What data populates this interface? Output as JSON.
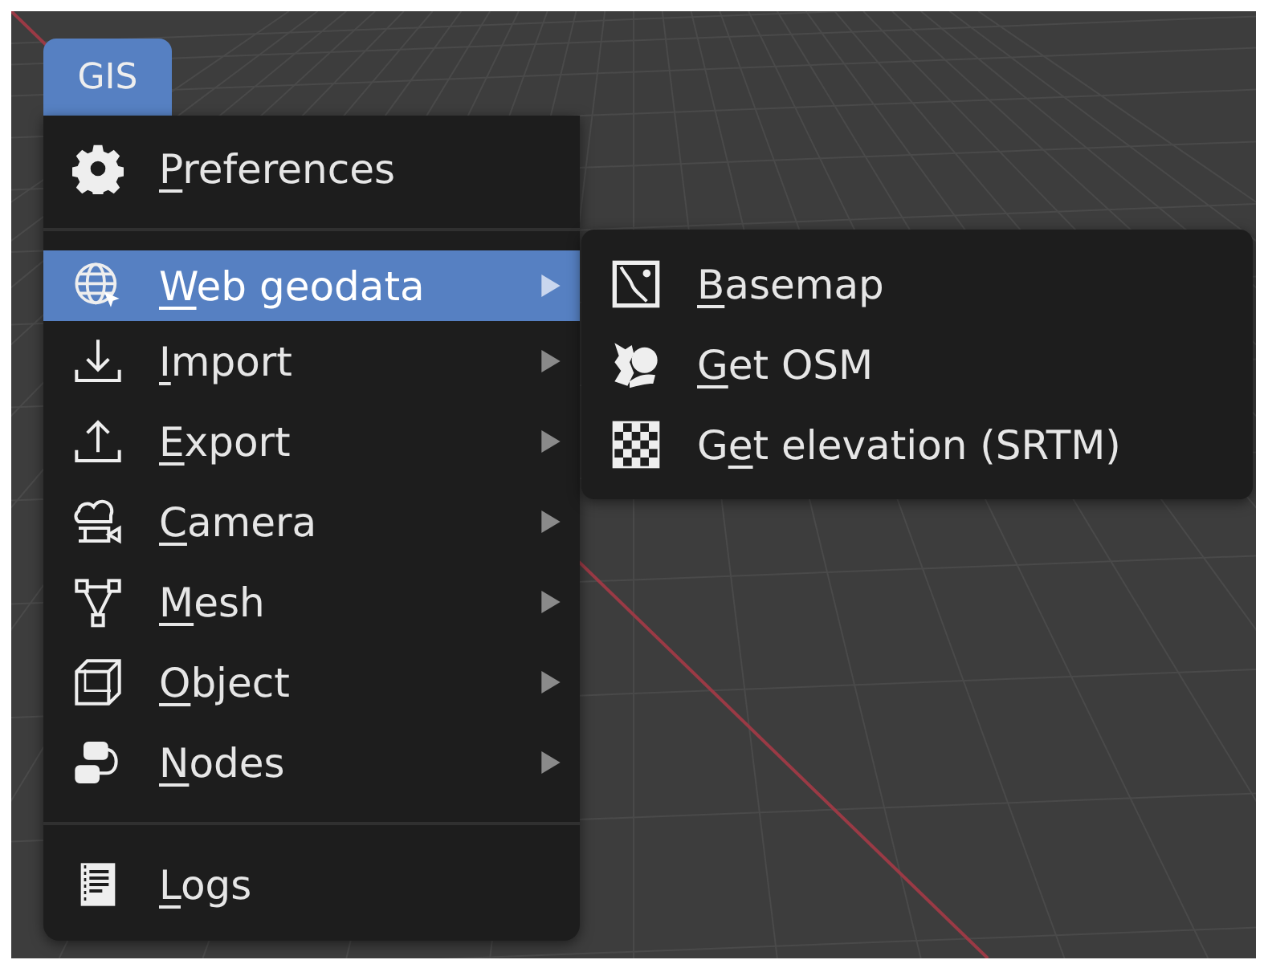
{
  "menu_tab": {
    "label": "GIS",
    "selected": true
  },
  "menu": {
    "sections": [
      {
        "items": [
          {
            "label": "Preferences",
            "selected": false,
            "submenu": false
          }
        ]
      },
      {
        "items": [
          {
            "label": "Web geodata",
            "selected": true,
            "submenu": true
          },
          {
            "label": "Import",
            "selected": false,
            "submenu": true
          },
          {
            "label": "Export",
            "selected": false,
            "submenu": true
          },
          {
            "label": "Camera",
            "selected": false,
            "submenu": true
          },
          {
            "label": "Mesh",
            "selected": false,
            "submenu": true
          },
          {
            "label": "Object",
            "selected": false,
            "submenu": true
          },
          {
            "label": "Nodes",
            "selected": false,
            "submenu": true
          }
        ]
      },
      {
        "items": [
          {
            "label": "Logs",
            "selected": false,
            "submenu": false
          }
        ]
      }
    ]
  },
  "submenu": {
    "items": [
      {
        "label": "Basemap"
      },
      {
        "label": "Get OSM"
      },
      {
        "label": "Get elevation (SRTM)"
      }
    ]
  }
}
